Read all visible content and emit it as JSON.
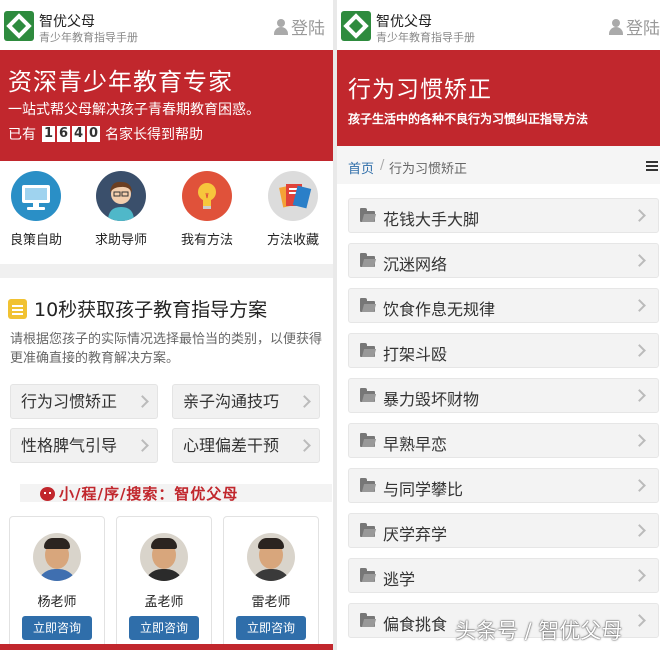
{
  "header": {
    "brand_name": "智优父母",
    "brand_sub": "青少年教育指导手册",
    "login_label": "登陆"
  },
  "left": {
    "banner": {
      "title": "资深青少年教育专家",
      "subtitle": "一站式帮父母解决孩子青春期教育困惑。",
      "count_prefix": "已有",
      "count_digits": [
        "1",
        "6",
        "4",
        "0"
      ],
      "count_suffix": "名家长得到帮助"
    },
    "icons": [
      {
        "label": "良策自助",
        "icon": "monitor-icon"
      },
      {
        "label": "求助导师",
        "icon": "teacher-icon"
      },
      {
        "label": "我有方法",
        "icon": "lightbulb-icon"
      },
      {
        "label": "方法收藏",
        "icon": "documents-icon"
      }
    ],
    "section_title": "10秒获取孩子教育指导方案",
    "section_desc": "请根据您孩子的实际情况选择最恰当的类别，以便获得更准确直接的教育解决方案。",
    "categories": [
      "行为习惯矫正",
      "亲子沟通技巧",
      "性格脾气引导",
      "心理偏差干预"
    ],
    "search_text": "小/程/序/搜索：智优父母",
    "teachers": [
      {
        "name": "杨老师",
        "button": "立即咨询"
      },
      {
        "name": "孟老师",
        "button": "立即咨询"
      },
      {
        "name": "雷老师",
        "button": "立即咨询"
      }
    ]
  },
  "right": {
    "banner": {
      "title": "行为习惯矫正",
      "subtitle": "孩子生活中的各种不良行为习惯纠正指导方法"
    },
    "breadcrumb": {
      "home": "首页",
      "sep": "/",
      "current": "行为习惯矫正"
    },
    "items": [
      "花钱大手大脚",
      "沉迷网络",
      "饮食作息无规律",
      "打架斗殴",
      "暴力毁坏财物",
      "早熟早恋",
      "与同学攀比",
      "厌学弃学",
      "逃学",
      "偏食挑食"
    ]
  },
  "watermark": "头条号 / 智优父母",
  "colors": {
    "brand_red": "#c1272d",
    "brand_green": "#2e8b3e",
    "button_blue": "#2f6eaa"
  }
}
